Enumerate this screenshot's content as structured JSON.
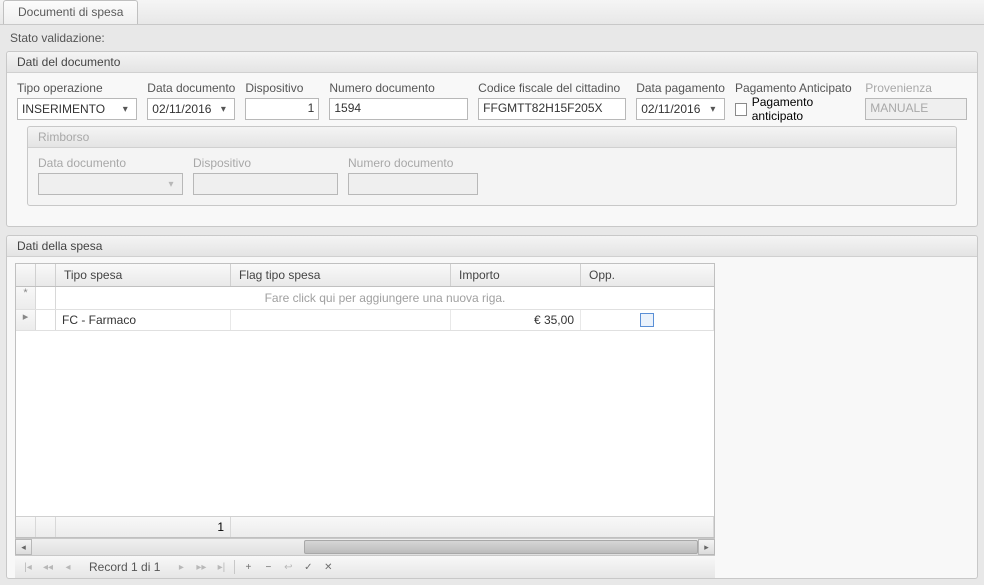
{
  "tab": {
    "title": "Documenti di spesa"
  },
  "status": {
    "label": "Stato validazione:"
  },
  "doc": {
    "group_title": "Dati del documento",
    "op": {
      "label": "Tipo operazione",
      "value": "INSERIMENTO"
    },
    "data": {
      "label": "Data documento",
      "value": "02/11/2016"
    },
    "disp": {
      "label": "Dispositivo",
      "value": "1"
    },
    "num": {
      "label": "Numero documento",
      "value": "1594"
    },
    "cf": {
      "label": "Codice fiscale del cittadino",
      "value": "FFGMTT82H15F205X"
    },
    "pag": {
      "label": "Data pagamento",
      "value": "02/11/2016"
    },
    "ant": {
      "label": "Pagamento Anticipato",
      "chk_label": "Pagamento anticipato"
    },
    "prov": {
      "label": "Provenienza",
      "value": "MANUALE"
    }
  },
  "rimb": {
    "group_title": "Rimborso",
    "data": {
      "label": "Data documento",
      "value": ""
    },
    "disp": {
      "label": "Dispositivo",
      "value": ""
    },
    "num": {
      "label": "Numero documento",
      "value": ""
    }
  },
  "spesa": {
    "group_title": "Dati della spesa",
    "cols": {
      "tipo": "Tipo spesa",
      "flag": "Flag tipo spesa",
      "imp": "Importo",
      "opp": "Opp."
    },
    "newrow_hint": "Fare click qui per aggiungere una nuova riga.",
    "row": {
      "tipo": "FC - Farmaco",
      "flag": "",
      "imp": "€ 35,00"
    },
    "summary_count": "1",
    "nav": {
      "text": "Record 1 di 1"
    }
  }
}
